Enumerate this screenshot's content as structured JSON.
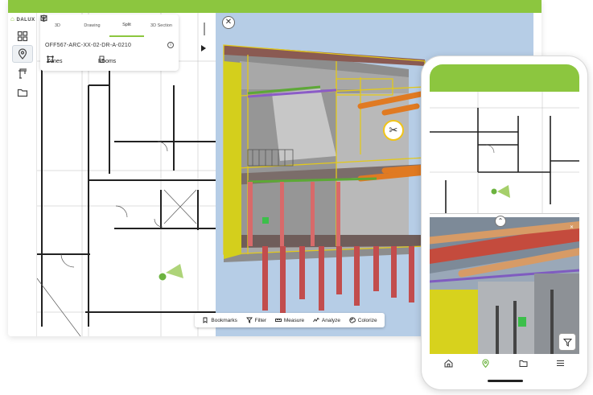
{
  "app": {
    "logo_text": "DALUX"
  },
  "sidebar": {
    "items": [
      {
        "name": "grid",
        "icon": "grid-icon"
      },
      {
        "name": "location",
        "icon": "location-pin-icon",
        "active": true
      },
      {
        "name": "crane",
        "icon": "crane-icon"
      },
      {
        "name": "folder",
        "icon": "folder-icon"
      }
    ]
  },
  "view_panel": {
    "modes": [
      {
        "label": "3D",
        "icon": "cube-icon"
      },
      {
        "label": "Drawing",
        "icon": "drawing-icon"
      },
      {
        "label": "Split",
        "icon": "split-icon",
        "active": true
      },
      {
        "label": "3D Section",
        "icon": "section-cube-icon"
      }
    ],
    "document_name": "OFF567-ARC-XX-02-DR-A-0210",
    "zones_label": "Zones",
    "rooms_label": "Rooms"
  },
  "toolbar3d": {
    "items": [
      {
        "label": "Bookmarks",
        "icon": "bookmark-icon"
      },
      {
        "label": "Filter",
        "icon": "filter-icon"
      },
      {
        "label": "Measure",
        "icon": "measure-icon"
      },
      {
        "label": "Analyze",
        "icon": "analyze-icon"
      },
      {
        "label": "Colorize",
        "icon": "palette-icon"
      }
    ]
  },
  "colors": {
    "brand": "#8cc63f",
    "sky": "#b6cde6",
    "accent_yellow": "#f0c419"
  },
  "phone": {
    "nav": [
      {
        "icon": "home-icon"
      },
      {
        "icon": "location-pin-icon",
        "active": true
      },
      {
        "icon": "folder-icon"
      },
      {
        "icon": "menu-icon"
      }
    ]
  }
}
